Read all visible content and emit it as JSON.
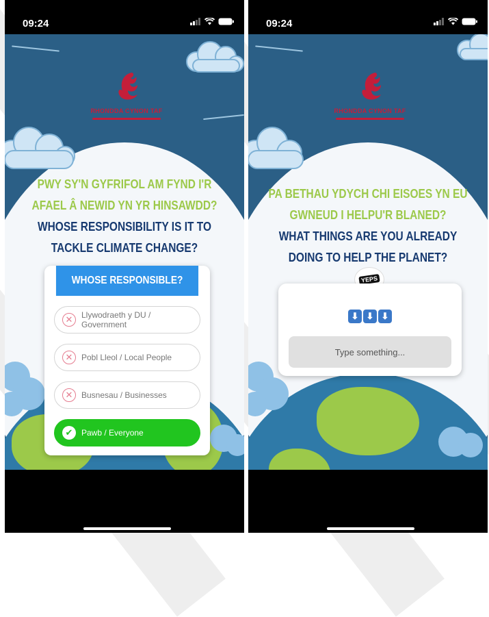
{
  "left_screen": {
    "time": "09:24",
    "logo_text": "RHONDDA CYNON TAF",
    "question_welsh": [
      "PWY SY'N GYFRIFOL AM FYND I'R",
      "AFAEL Â NEWID YN YR HINSAWDD?"
    ],
    "question_english": [
      "WHOSE RESPONSIBILITY IS IT TO",
      "TACKLE CLIMATE CHANGE?"
    ],
    "poll": {
      "header": "WHOSE RESPONSIBLE?",
      "options": [
        {
          "label_line1": "Llywodraeth y DU /",
          "label_line2": "Government",
          "selected": false,
          "icon": "x-circle-icon"
        },
        {
          "label_line1": "Pobl Lleol / Local People",
          "label_line2": "",
          "selected": false,
          "icon": "x-circle-icon"
        },
        {
          "label_line1": "Busnesau / Businesses",
          "label_line2": "",
          "selected": false,
          "icon": "x-circle-icon"
        },
        {
          "label_line1": "Pawb / Everyone",
          "label_line2": "",
          "selected": true,
          "icon": "check-circle-icon"
        }
      ]
    }
  },
  "right_screen": {
    "time": "09:24",
    "logo_text": "RHONDDA CYNON TAF",
    "question_welsh": [
      "PA BETHAU YDYCH CHI EISOES YN EU",
      "GWNEUD I HELPU'R BLANED?"
    ],
    "question_english": [
      "WHAT THINGS ARE YOU ALREADY",
      "DOING TO HELP THE PLANET?"
    ],
    "sticker_label": "YEPS",
    "emojis": [
      "⬇",
      "⬇",
      "⬇"
    ],
    "input_placeholder": "Type something..."
  },
  "colors": {
    "sky": "#2b5f86",
    "green_text": "#9cc94a",
    "navy_text": "#173a70",
    "poll_header": "#2f93e8",
    "selected": "#21c51f",
    "brand_red": "#c41e3a"
  }
}
